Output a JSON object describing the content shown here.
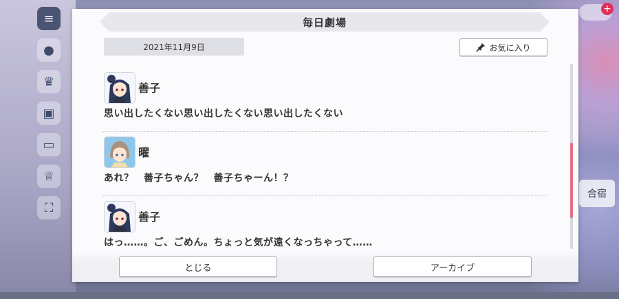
{
  "dialog": {
    "title": "毎日劇場",
    "date": "2021年11月9日",
    "favorite_label": "お気に入り",
    "scroll_position": 0.6
  },
  "messages": [
    {
      "speaker": "善子",
      "text": "思い出したくない思い出したくない思い出したくない",
      "avatar": "yoshiko-avatar"
    },
    {
      "speaker": "曜",
      "text": "あれ？　善子ちゃん？　善子ちゃーん！？",
      "avatar": "you-avatar"
    },
    {
      "speaker": "善子",
      "text": "はっ……。ご、ごめん。ちょっと気が遠くなっちゃって……",
      "avatar": "yoshiko-avatar"
    }
  ],
  "footer": {
    "close_label": "とじる",
    "archive_label": "アーカイブ"
  },
  "background": {
    "right_badge": "合宿"
  },
  "colors": {
    "accent_scroll": "#e46f86",
    "panel": "#fbfbfd",
    "title_bar": "#e7e7ec"
  }
}
